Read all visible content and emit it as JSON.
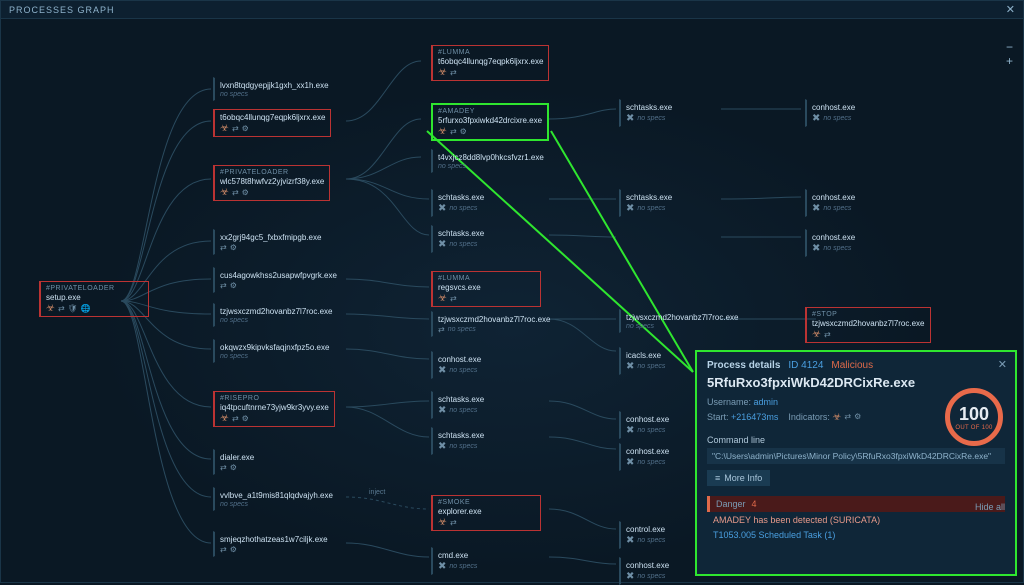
{
  "title": "PROCESSES GRAPH",
  "zoom_icons": {
    "minus": "−",
    "plus": "+"
  },
  "inject_label": "inject",
  "root": {
    "tag": "#PRIVATELOADER",
    "name": "setup.exe",
    "icons": [
      "bio",
      "arrow",
      "shield",
      "net"
    ]
  },
  "col2": [
    {
      "name": "lvxn8tqdgyepjjk1gxh_xx1h.exe",
      "meta": "no specs",
      "red": false
    },
    {
      "name": "t6obqc4llunqg7eqpk6ljxrx.exe",
      "red": true,
      "icons": [
        "bio",
        "arrow",
        "gear"
      ]
    },
    {
      "tag": "#PRIVATELOADER",
      "name": "wlc578t8hwfvz2yjvizrf38y.exe",
      "red": true,
      "icons": [
        "bio",
        "arrow",
        "gear"
      ]
    },
    {
      "name": "xx2grj94gc5_fxbxfmipgb.exe",
      "red": false,
      "icons": [
        "arrow",
        "gear"
      ]
    },
    {
      "name": "cus4agowkhss2usapwfpvgrk.exe",
      "red": false,
      "icons": [
        "arrow",
        "gear"
      ]
    },
    {
      "name": "tzjwsxczmd2hovanbz7l7roc.exe",
      "red": false,
      "meta": "no specs"
    },
    {
      "name": "okqwzx9kipvksfaqjnxfpz5o.exe",
      "red": false,
      "meta": "no specs"
    },
    {
      "tag": "#RISEPRO",
      "name": "iq4tpcuftnrne73yjw9kr3yvy.exe",
      "red": true,
      "icons": [
        "bio",
        "arrow",
        "gear"
      ]
    },
    {
      "name": "dialer.exe",
      "red": false,
      "icons": [
        "arrow",
        "gear"
      ]
    },
    {
      "name": "vvlbve_a1t9mis81qlqdvajyh.exe",
      "red": false,
      "meta": "no specs"
    },
    {
      "name": "smjeqzhothatzeas1w7ciljk.exe",
      "red": false,
      "icons": [
        "arrow",
        "gear"
      ]
    }
  ],
  "col3": [
    {
      "tag": "#LUMMA",
      "name": "t6obqc4llunqg7eqpk6ljxrx.exe",
      "red": true,
      "icons": [
        "bio",
        "arrow"
      ]
    },
    {
      "tag": "#AMADEY",
      "name": "5rfurxo3fpxiwkd42drcixre.exe",
      "red": true,
      "sel": true,
      "icons": [
        "bio",
        "arrow",
        "gear"
      ]
    },
    {
      "name": "t4vxjcz8dd8lvp0hkcsfvzr1.exe",
      "red": false,
      "meta": "no specs"
    },
    {
      "name": "schtasks.exe",
      "red": false,
      "meta": "no specs",
      "tool": true
    },
    {
      "name": "schtasks.exe",
      "red": false,
      "meta": "no specs",
      "tool": true
    },
    {
      "tag": "#LUMMA",
      "name": "regsvcs.exe",
      "red": true,
      "icons": [
        "bio",
        "arrow"
      ]
    },
    {
      "name": "tzjwsxczmd2hovanbz7l7roc.exe",
      "red": false,
      "icons": [
        "arrow"
      ],
      "meta": "no specs"
    },
    {
      "name": "conhost.exe",
      "red": false,
      "meta": "no specs",
      "tool": true
    },
    {
      "name": "schtasks.exe",
      "red": false,
      "meta": "no specs",
      "tool": true
    },
    {
      "name": "schtasks.exe",
      "red": false,
      "meta": "no specs",
      "tool": true
    },
    {
      "tag": "#SMOKE",
      "name": "explorer.exe",
      "red": true,
      "icons": [
        "bio",
        "arrow"
      ]
    },
    {
      "name": "cmd.exe",
      "red": false,
      "meta": "no specs",
      "tool": true
    }
  ],
  "col4": [
    {
      "name": "schtasks.exe",
      "red": false,
      "meta": "no specs",
      "tool": true
    },
    {
      "name": "schtasks.exe",
      "red": false,
      "meta": "no specs",
      "tool": true
    },
    {
      "name": "tzjwsxczmd2hovanbz7l7roc.exe",
      "red": false,
      "meta": "no specs"
    },
    {
      "name": "icacls.exe",
      "red": false,
      "meta": "no specs",
      "tool": true
    },
    {
      "name": "conhost.exe",
      "red": false,
      "meta": "no specs",
      "tool": true
    },
    {
      "name": "conhost.exe",
      "red": false,
      "meta": "no specs",
      "tool": true
    },
    {
      "name": "control.exe",
      "red": false,
      "meta": "no specs",
      "tool": true
    },
    {
      "name": "conhost.exe",
      "red": false,
      "meta": "no specs",
      "tool": true
    }
  ],
  "col5": [
    {
      "name": "conhost.exe",
      "meta": "no specs",
      "tool": true
    },
    {
      "name": "conhost.exe",
      "meta": "no specs",
      "tool": true
    },
    {
      "name": "conhost.exe",
      "meta": "no specs",
      "tool": true
    },
    {
      "tag": "#STOP",
      "name": "tzjwsxczmd2hovanbz7l7roc.exe",
      "red": true,
      "icons": [
        "bio",
        "arrow"
      ]
    }
  ],
  "details": {
    "header_label": "Process details",
    "pid_label": "ID 4124",
    "malicious": "Malicious",
    "process": "5RfuRxo3fpxiWkD42DRCixRe.exe",
    "username_label": "Username:",
    "username": "admin",
    "start_label": "Start:",
    "start": "+216473ms",
    "indicators_label": "Indicators:",
    "score": "100",
    "score_sub": "OUT OF 100",
    "cmd_label": "Command line",
    "cmd": "\"C:\\Users\\admin\\Pictures\\Minor Policy\\5RfuRxo3fpxiWkD42DRCixRe.exe\"",
    "more": "More Info",
    "hide": "Hide all",
    "danger_label": "Danger",
    "danger_count": "4",
    "danger_msg": "AMADEY has been detected (SURICATA)",
    "technique": "T1053.005 Scheduled Task (1)"
  }
}
